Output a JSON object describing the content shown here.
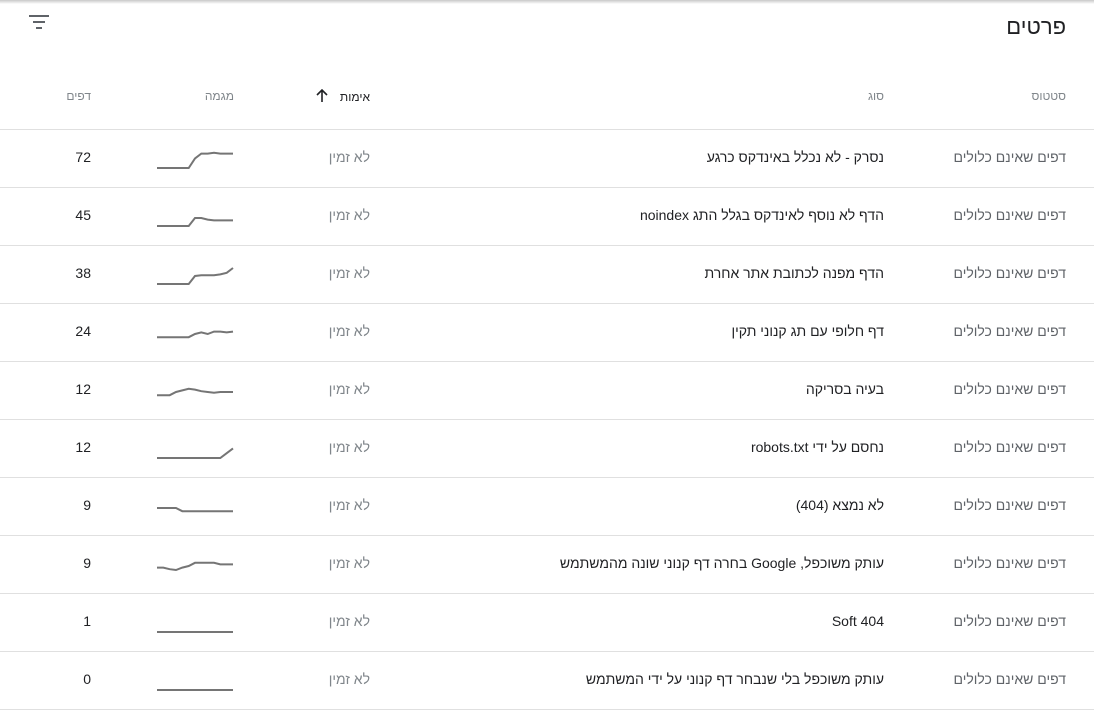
{
  "card": {
    "title": "פרטים",
    "filter_icon": "filter-icon"
  },
  "columns": {
    "status": "סטטוס",
    "type": "סוג",
    "validation": "אימות",
    "trend": "מגמה",
    "pages": "דפים"
  },
  "sort_icon": "arrow-up-icon",
  "colors": {
    "sparkline": "#757575",
    "divider": "#e0e0e0",
    "muted_text": "#80868b"
  },
  "rows": [
    {
      "status": "דפים שאינם כלולים",
      "type": "נסרק - לא נכלל באינדקס כרגע",
      "validation": "לא זמין",
      "trend": [
        0,
        0,
        0,
        0,
        0,
        0,
        0.6,
        0.9,
        0.9,
        0.95,
        0.9,
        0.9,
        0.9
      ],
      "pages": "72"
    },
    {
      "status": "דפים שאינם כלולים",
      "type": "הדף לא נוסף לאינדקס בגלל התג noindex",
      "validation": "לא זמין",
      "trend": [
        0,
        0,
        0,
        0,
        0,
        0,
        0.5,
        0.5,
        0.4,
        0.35,
        0.35,
        0.35,
        0.35
      ],
      "pages": "45"
    },
    {
      "status": "דפים שאינם כלולים",
      "type": "הדף מפנה לכתובת אתר אחרת",
      "validation": "לא זמין",
      "trend": [
        0,
        0,
        0,
        0,
        0,
        0,
        0.5,
        0.55,
        0.55,
        0.55,
        0.6,
        0.7,
        1
      ],
      "pages": "38"
    },
    {
      "status": "דפים שאינם כלולים",
      "type": "דף חלופי עם תג קנוני תקין",
      "validation": "לא זמין",
      "trend": [
        0.3,
        0.3,
        0.3,
        0.3,
        0.3,
        0.3,
        0.5,
        0.6,
        0.5,
        0.65,
        0.65,
        0.6,
        0.65
      ],
      "pages": "24"
    },
    {
      "status": "דפים שאינם כלולים",
      "type": "בעיה בסריקה",
      "validation": "לא זמין",
      "trend": [
        0.3,
        0.3,
        0.3,
        0.5,
        0.6,
        0.7,
        0.65,
        0.55,
        0.5,
        0.45,
        0.5,
        0.5,
        0.5
      ],
      "pages": "12"
    },
    {
      "status": "דפים שאינם כלולים",
      "type": "נחסם על ידי robots.txt",
      "validation": "לא זמין",
      "trend": [
        0,
        0,
        0,
        0,
        0,
        0,
        0,
        0,
        0,
        0,
        0,
        0.3,
        0.6
      ],
      "pages": "12"
    },
    {
      "status": "דפים שאינם כלולים",
      "type": "לא נמצא (404)",
      "validation": "לא זמין",
      "trend": [
        0.5,
        0.5,
        0.5,
        0.5,
        0.3,
        0.3,
        0.3,
        0.3,
        0.3,
        0.3,
        0.3,
        0.3,
        0.3
      ],
      "pages": "9"
    },
    {
      "status": "דפים שאינם כלולים",
      "type": "עותק משוכפל, Google בחרה דף קנוני שונה מהמשתמש",
      "validation": "לא זמין",
      "trend": [
        0.4,
        0.4,
        0.3,
        0.25,
        0.4,
        0.5,
        0.7,
        0.7,
        0.7,
        0.7,
        0.6,
        0.6,
        0.6
      ],
      "pages": "9"
    },
    {
      "status": "דפים שאינם כלולים",
      "type": "Soft 404",
      "validation": "לא זמין",
      "trend": [
        0,
        0,
        0,
        0,
        0,
        0,
        0,
        0,
        0,
        0,
        0,
        0,
        0
      ],
      "pages": "1"
    },
    {
      "status": "דפים שאינם כלולים",
      "type": "עותק משוכפל בלי שנבחר דף קנוני על ידי המשתמש",
      "validation": "לא זמין",
      "trend": [
        0,
        0,
        0,
        0,
        0,
        0,
        0,
        0,
        0,
        0,
        0,
        0,
        0
      ],
      "pages": "0"
    }
  ]
}
